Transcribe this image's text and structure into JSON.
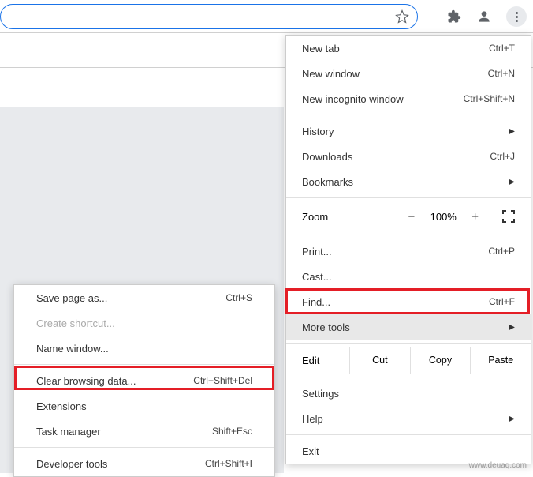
{
  "toolbar": {
    "extensions_icon": "puzzle-icon",
    "profile_icon": "profile-icon",
    "menu_icon": "more-vert-icon"
  },
  "main_menu": {
    "new_tab": {
      "label": "New tab",
      "shortcut": "Ctrl+T"
    },
    "new_window": {
      "label": "New window",
      "shortcut": "Ctrl+N"
    },
    "new_incognito": {
      "label": "New incognito window",
      "shortcut": "Ctrl+Shift+N"
    },
    "history": {
      "label": "History"
    },
    "downloads": {
      "label": "Downloads",
      "shortcut": "Ctrl+J"
    },
    "bookmarks": {
      "label": "Bookmarks"
    },
    "zoom": {
      "label": "Zoom",
      "minus": "−",
      "pct": "100%",
      "plus": "+"
    },
    "print": {
      "label": "Print...",
      "shortcut": "Ctrl+P"
    },
    "cast": {
      "label": "Cast..."
    },
    "find": {
      "label": "Find...",
      "shortcut": "Ctrl+F"
    },
    "more_tools": {
      "label": "More tools"
    },
    "edit": {
      "label": "Edit",
      "cut": "Cut",
      "copy": "Copy",
      "paste": "Paste"
    },
    "settings": {
      "label": "Settings"
    },
    "help": {
      "label": "Help"
    },
    "exit": {
      "label": "Exit"
    }
  },
  "sub_menu": {
    "save_page": {
      "label": "Save page as...",
      "shortcut": "Ctrl+S"
    },
    "create_shortcut": {
      "label": "Create shortcut..."
    },
    "name_window": {
      "label": "Name window..."
    },
    "clear_browsing": {
      "label": "Clear browsing data...",
      "shortcut": "Ctrl+Shift+Del"
    },
    "extensions": {
      "label": "Extensions"
    },
    "task_manager": {
      "label": "Task manager",
      "shortcut": "Shift+Esc"
    },
    "developer_tools": {
      "label": "Developer tools",
      "shortcut": "Ctrl+Shift+I"
    }
  },
  "watermark": "www.deuaq.com"
}
